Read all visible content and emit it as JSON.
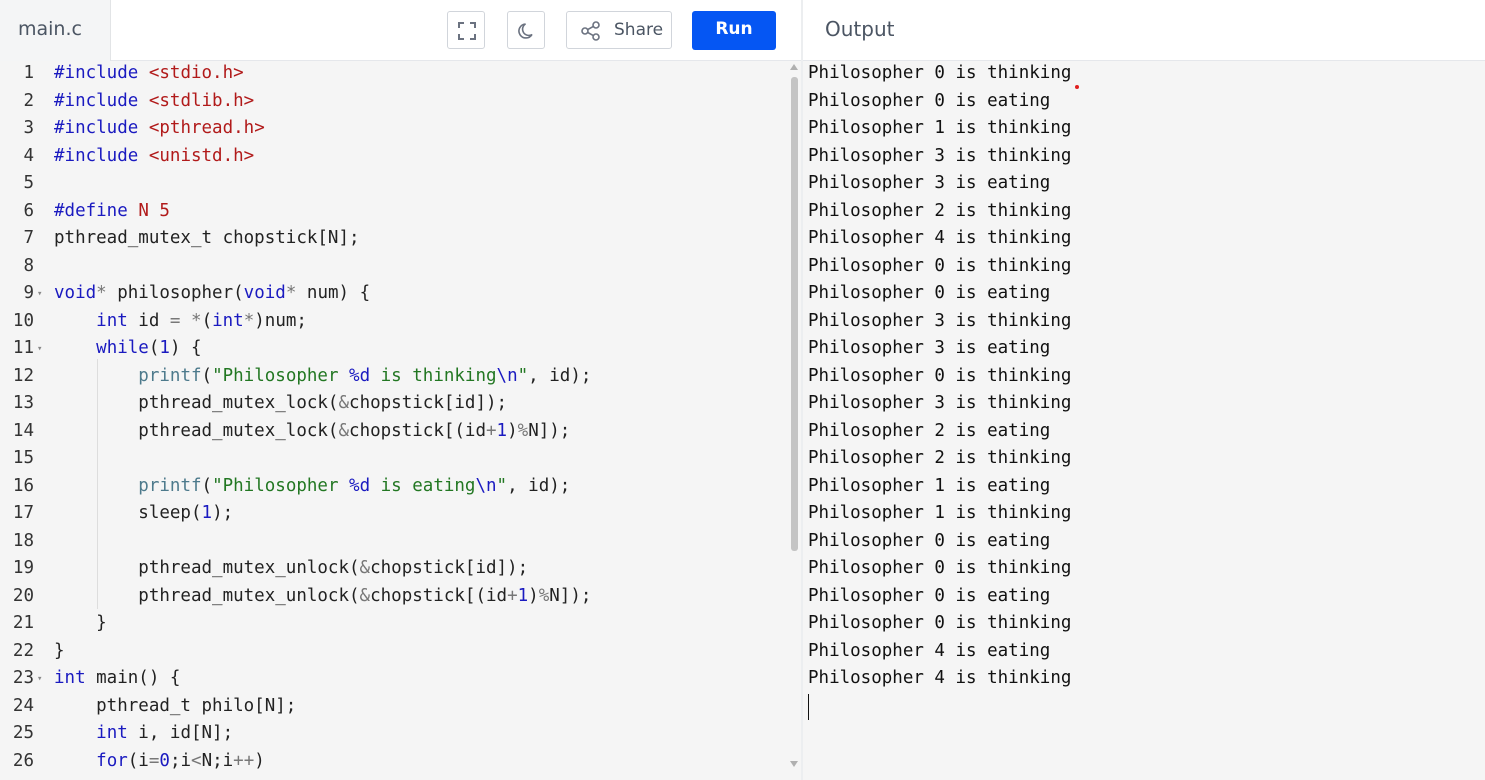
{
  "header": {
    "file_tab": "main.c",
    "share_label": "Share",
    "run_label": "Run",
    "output_title": "Output",
    "icons": [
      "fullscreen-icon",
      "dark-mode-icon",
      "share-icon"
    ]
  },
  "colors": {
    "run_button": "#0556f3",
    "keyword": "#1a1ac0",
    "string": "#227722",
    "number": "#b11a1a"
  },
  "editor": {
    "lines": [
      {
        "n": "1",
        "text": "#include <stdio.h>"
      },
      {
        "n": "2",
        "text": "#include <stdlib.h>"
      },
      {
        "n": "3",
        "text": "#include <pthread.h>"
      },
      {
        "n": "4",
        "text": "#include <unistd.h>"
      },
      {
        "n": "5",
        "text": ""
      },
      {
        "n": "6",
        "text": "#define N 5"
      },
      {
        "n": "7",
        "text": "pthread_mutex_t chopstick[N];"
      },
      {
        "n": "8",
        "text": ""
      },
      {
        "n": "9",
        "text": "void* philosopher(void* num) {"
      },
      {
        "n": "10",
        "text": "    int id = *(int*)num;"
      },
      {
        "n": "11",
        "text": "    while(1) {"
      },
      {
        "n": "12",
        "text": "        printf(\"Philosopher %d is thinking\\n\", id);"
      },
      {
        "n": "13",
        "text": "        pthread_mutex_lock(&chopstick[id]);"
      },
      {
        "n": "14",
        "text": "        pthread_mutex_lock(&chopstick[(id+1)%N]);"
      },
      {
        "n": "15",
        "text": ""
      },
      {
        "n": "16",
        "text": "        printf(\"Philosopher %d is eating\\n\", id);"
      },
      {
        "n": "17",
        "text": "        sleep(1);"
      },
      {
        "n": "18",
        "text": ""
      },
      {
        "n": "19",
        "text": "        pthread_mutex_unlock(&chopstick[id]);"
      },
      {
        "n": "20",
        "text": "        pthread_mutex_unlock(&chopstick[(id+1)%N]);"
      },
      {
        "n": "21",
        "text": "    }"
      },
      {
        "n": "22",
        "text": "}"
      },
      {
        "n": "23",
        "text": "int main() {"
      },
      {
        "n": "24",
        "text": "    pthread_t philo[N];"
      },
      {
        "n": "25",
        "text": "    int i, id[N];"
      },
      {
        "n": "26",
        "text": "    for(i=0;i<N;i++)"
      }
    ],
    "fold_markers_on_lines": [
      "9",
      "11",
      "23"
    ]
  },
  "output": {
    "lines": [
      "Philosopher 0 is thinking",
      "Philosopher 0 is eating",
      "Philosopher 1 is thinking",
      "Philosopher 3 is thinking",
      "Philosopher 3 is eating",
      "Philosopher 2 is thinking",
      "Philosopher 4 is thinking",
      "Philosopher 0 is thinking",
      "Philosopher 0 is eating",
      "Philosopher 3 is thinking",
      "Philosopher 3 is eating",
      "Philosopher 0 is thinking",
      "Philosopher 3 is thinking",
      "Philosopher 2 is eating",
      "Philosopher 2 is thinking",
      "Philosopher 1 is eating",
      "Philosopher 1 is thinking",
      "Philosopher 0 is eating",
      "Philosopher 0 is thinking",
      "Philosopher 0 is eating",
      "Philosopher 0 is thinking",
      "Philosopher 4 is eating",
      "Philosopher 4 is thinking"
    ]
  }
}
